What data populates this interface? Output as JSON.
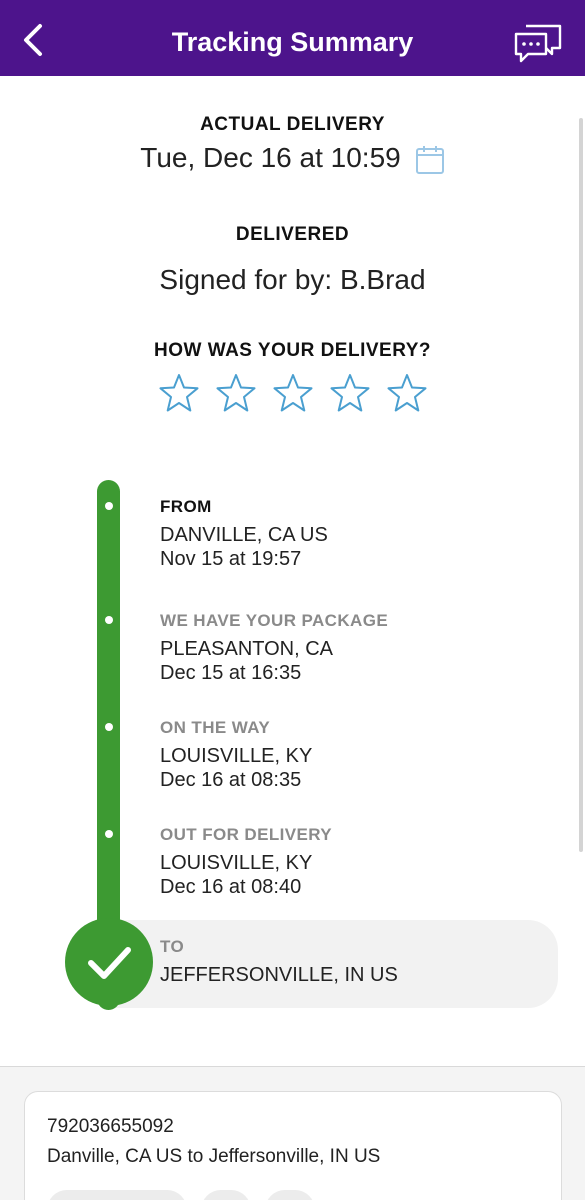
{
  "header": {
    "title": "Tracking Summary",
    "bg_color": "#4d148c"
  },
  "delivery": {
    "actual_label": "ACTUAL DELIVERY",
    "actual_date": "Tue, Dec 16 at 10:59",
    "status_label": "DELIVERED",
    "signed_for": "Signed for by: B.Brad"
  },
  "rating": {
    "prompt": "HOW WAS YOUR DELIVERY?",
    "rating": 0,
    "max": 5,
    "star_color": "#4a9fd0"
  },
  "timeline": {
    "color": "#3d9a32",
    "events": [
      {
        "title": "FROM",
        "location": "DANVILLE, CA US",
        "time": "Nov 15 at 19:57"
      },
      {
        "title": "WE HAVE YOUR PACKAGE",
        "location": "PLEASANTON, CA",
        "time": "Dec 15 at 16:35"
      },
      {
        "title": "ON THE WAY",
        "location": "LOUISVILLE, KY",
        "time": "Dec 16 at 08:35"
      },
      {
        "title": "OUT FOR DELIVERY",
        "location": "LOUISVILLE, KY",
        "time": "Dec 16 at 08:40"
      },
      {
        "title": "TO",
        "location": "JEFFERSONVILLE, IN  US"
      }
    ]
  },
  "shipment_card": {
    "tracking_number": "792036655092",
    "route": "Danville, CA US to Jeffersonville, IN US"
  }
}
